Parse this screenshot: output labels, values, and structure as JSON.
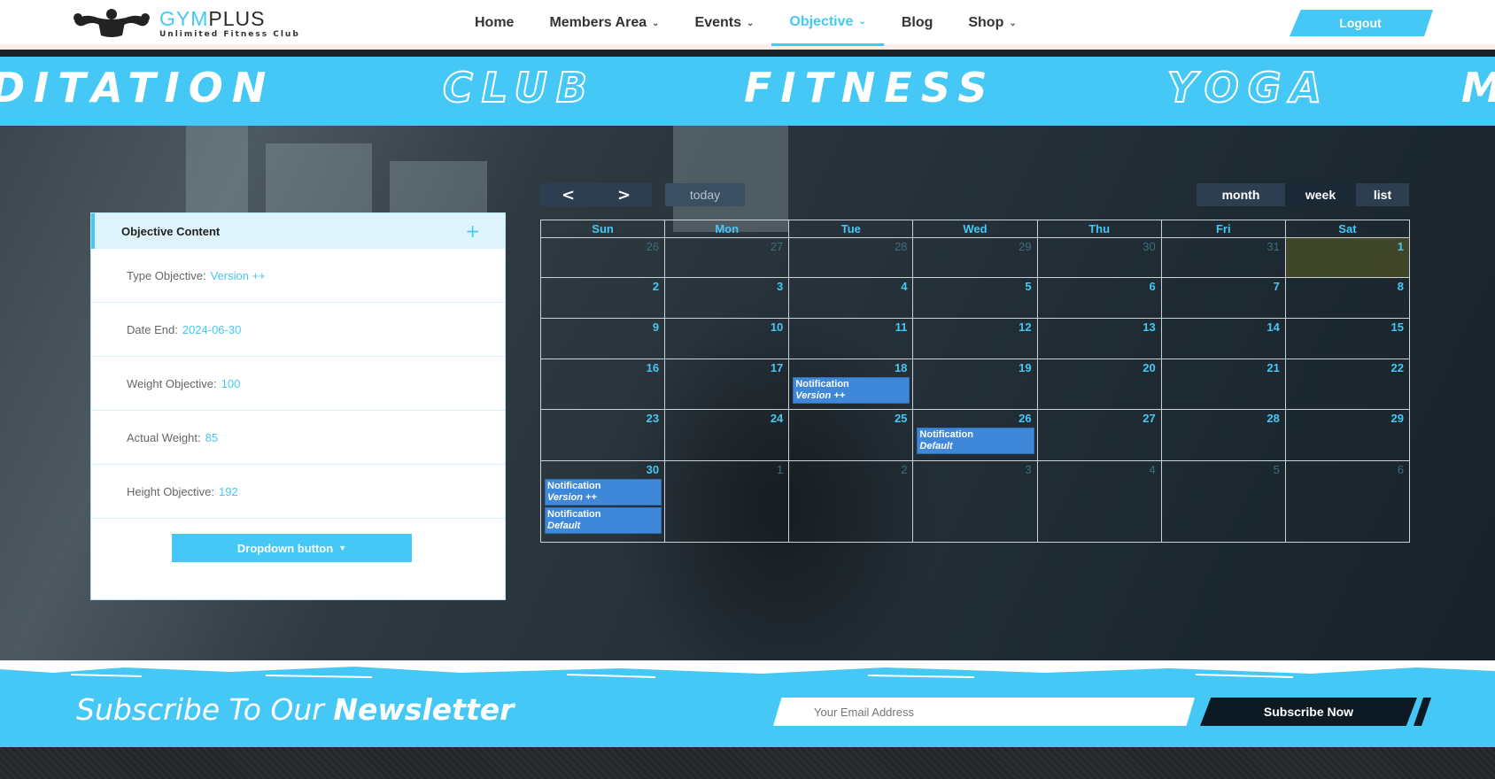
{
  "brand": {
    "name_part1": "GYM",
    "name_part2": "PLUS",
    "tagline": "Unlimited Fitness Club"
  },
  "nav": {
    "items": [
      {
        "label": "Home",
        "has_dropdown": false,
        "active": false
      },
      {
        "label": "Members Area",
        "has_dropdown": true,
        "active": false
      },
      {
        "label": "Events",
        "has_dropdown": true,
        "active": false
      },
      {
        "label": "Objective",
        "has_dropdown": true,
        "active": true
      },
      {
        "label": "Blog",
        "has_dropdown": false,
        "active": false
      },
      {
        "label": "Shop",
        "has_dropdown": true,
        "active": false
      }
    ],
    "logout_label": "Logout"
  },
  "banner": {
    "words": [
      "DITATION",
      "CLUB",
      "FITNESS",
      "YOGA",
      "M"
    ]
  },
  "objective": {
    "title": "Objective Content",
    "rows": [
      {
        "label": "Type Objective:",
        "value": "Version ++"
      },
      {
        "label": "Date End:",
        "value": "2024-06-30"
      },
      {
        "label": "Weight Objective:",
        "value": "100"
      },
      {
        "label": "Actual Weight:",
        "value": "85"
      },
      {
        "label": "Height Objective:",
        "value": "192"
      }
    ],
    "dropdown_label": "Dropdown button"
  },
  "calendar": {
    "prev": "<",
    "next": ">",
    "today_label": "today",
    "views": [
      "month",
      "week",
      "list"
    ],
    "active_view": "week",
    "weekdays": [
      "Sun",
      "Mon",
      "Tue",
      "Wed",
      "Thu",
      "Fri",
      "Sat"
    ],
    "weeks": [
      [
        {
          "d": "26",
          "o": true
        },
        {
          "d": "27",
          "o": true
        },
        {
          "d": "28",
          "o": true
        },
        {
          "d": "29",
          "o": true
        },
        {
          "d": "30",
          "o": true
        },
        {
          "d": "31",
          "o": true
        },
        {
          "d": "1",
          "t": true
        }
      ],
      [
        {
          "d": "2"
        },
        {
          "d": "3"
        },
        {
          "d": "4"
        },
        {
          "d": "5"
        },
        {
          "d": "6"
        },
        {
          "d": "7"
        },
        {
          "d": "8"
        }
      ],
      [
        {
          "d": "9"
        },
        {
          "d": "10"
        },
        {
          "d": "11"
        },
        {
          "d": "12"
        },
        {
          "d": "13"
        },
        {
          "d": "14"
        },
        {
          "d": "15"
        }
      ],
      [
        {
          "d": "16"
        },
        {
          "d": "17"
        },
        {
          "d": "18",
          "ev": [
            {
              "title": "Notification",
              "sub": "Version ++"
            }
          ]
        },
        {
          "d": "19"
        },
        {
          "d": "20"
        },
        {
          "d": "21"
        },
        {
          "d": "22"
        }
      ],
      [
        {
          "d": "23"
        },
        {
          "d": "24"
        },
        {
          "d": "25"
        },
        {
          "d": "26",
          "ev": [
            {
              "title": "Notification",
              "sub": "Default"
            }
          ]
        },
        {
          "d": "27"
        },
        {
          "d": "28"
        },
        {
          "d": "29"
        }
      ],
      [
        {
          "d": "30",
          "ev": [
            {
              "title": "Notification",
              "sub": "Version ++"
            },
            {
              "title": "Notification",
              "sub": "Default"
            }
          ]
        },
        {
          "d": "1",
          "o": true
        },
        {
          "d": "2",
          "o": true
        },
        {
          "d": "3",
          "o": true
        },
        {
          "d": "4",
          "o": true
        },
        {
          "d": "5",
          "o": true
        },
        {
          "d": "6",
          "o": true
        }
      ]
    ]
  },
  "newsletter": {
    "title_light": "Subscribe To Our",
    "title_bold": "Newsletter",
    "email_placeholder": "Your Email Address",
    "button_label": "Subscribe Now"
  },
  "colors": {
    "accent": "#45c8f5",
    "event": "#3f87d9",
    "today": "#464b28",
    "dark_button": "#0d1a24"
  }
}
